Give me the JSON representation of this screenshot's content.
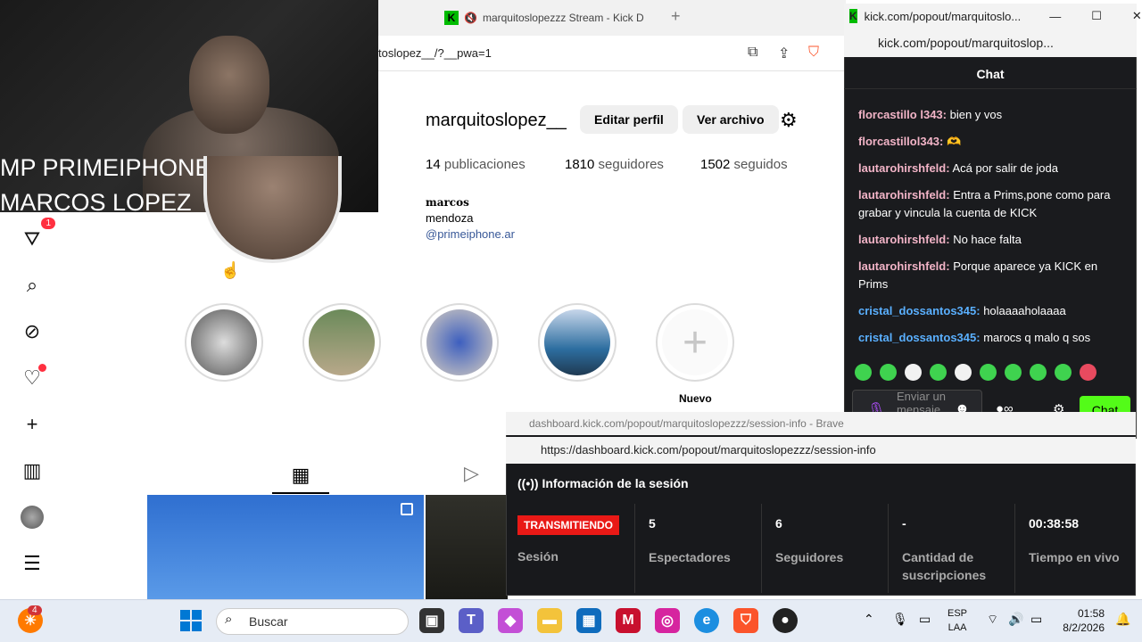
{
  "browser": {
    "tab_title": "marquitoslopezzz Stream - Kick D",
    "url_partial": "toslopez__/?__pwa=1"
  },
  "webcam": {
    "overlay_line1": "MP PRIMEIPHONE",
    "overlay_line2": "MARCOS LOPEZ"
  },
  "instagram": {
    "username": "marquitoslopez__",
    "edit_profile": "Editar perfil",
    "view_archive": "Ver archivo",
    "stats": [
      {
        "count": "14",
        "label": "publicaciones"
      },
      {
        "count": "1810",
        "label": "seguidores"
      },
      {
        "count": "1502",
        "label": "seguidos"
      }
    ],
    "display_name": "marcos",
    "city": "mendoza",
    "link": "@primeiphone.ar",
    "new_highlight_label": "Nuevo",
    "notification_count": "1"
  },
  "chat_popup": {
    "window_title": "kick.com/popout/marquitoslo...",
    "url": "kick.com/popout/marquitoslop...",
    "header": "Chat",
    "messages": [
      {
        "user": "florcastillo l343:",
        "text": " bien y vos"
      },
      {
        "user": "florcastillol343:",
        "text": " 🫶"
      },
      {
        "user": "lautarohirshfeld:",
        "text": " Acá por salir de joda"
      },
      {
        "user": "lautarohirshfeld:",
        "text": " Entra a Prims,pone como para grabar y vincula la cuenta de KICK"
      },
      {
        "user": "lautarohirshfeld:",
        "text": " No hace falta"
      },
      {
        "user": "lautarohirshfeld:",
        "text": " Porque aparece ya KICK en Prims"
      },
      {
        "user": "cristal_dossantos345:",
        "text": " holaaaaholaaaa"
      },
      {
        "user": "cristal_dossantos345:",
        "text": " marocs q malo q sos"
      }
    ],
    "input_placeholder": "Enviar un mensaje",
    "send_label": "Chat"
  },
  "session_popup": {
    "window_title": "dashboard.kick.com/popout/marquitoslopezzz/session-info - Brave",
    "url": "https://dashboard.kick.com/popout/marquitoslopezzz/session-info",
    "header": "Información de la sesión",
    "live_badge": "TRANSMITIENDO",
    "session_label": "Sesión",
    "metrics": [
      {
        "value": "5",
        "label": "Espectadores"
      },
      {
        "value": "6",
        "label": "Seguidores"
      },
      {
        "value": "-",
        "label": "Cantidad de suscripciones"
      },
      {
        "value": "00:38:58",
        "label": "Tiempo en vivo"
      }
    ]
  },
  "taskbar": {
    "search_placeholder": "Buscar",
    "lang_line1": "ESP",
    "lang_line2": "LAA",
    "time": "01:58",
    "date": "8/2/2026",
    "app_badge": "4"
  }
}
